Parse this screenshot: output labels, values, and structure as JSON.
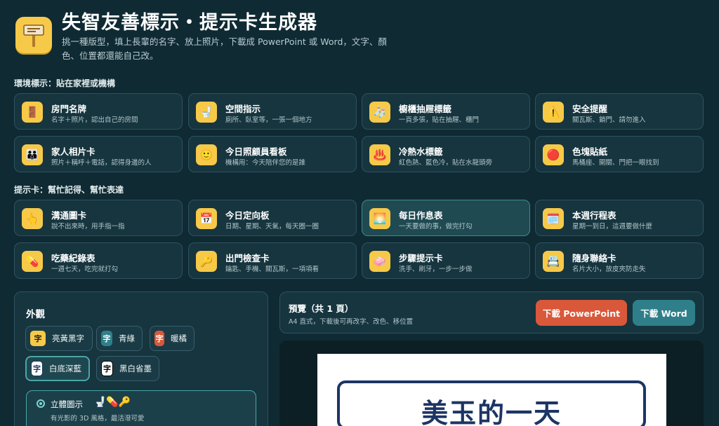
{
  "header": {
    "title": "失智友善標示・提示卡生成器",
    "subtitle": "挑一種版型，填上長輩的名字、放上照片，下載成 PowerPoint 或 Word，文字、顏色、位置都還能自己改。",
    "logo_icon": "signpost-icon"
  },
  "sections": {
    "environment": "環境標示：貼在家裡或機構",
    "prompt_cards": "提示卡：幫忙記得、幫忙表達"
  },
  "environment_cards": [
    {
      "title": "房門名牌",
      "desc": "名字＋照片，認出自己的房間",
      "icon": "door-icon",
      "glyph": "🚪"
    },
    {
      "title": "空間指示",
      "desc": "廁所、臥室等，一張一個地方",
      "icon": "toilet-icon",
      "glyph": "🚽"
    },
    {
      "title": "櫥櫃抽屜標籤",
      "desc": "一頁多張，貼在抽屜、櫃門",
      "icon": "socks-icon",
      "glyph": "🧦"
    },
    {
      "title": "安全提醒",
      "desc": "關瓦斯、鎖門、請勿進入",
      "icon": "warning-icon",
      "glyph": "⚠️"
    },
    {
      "title": "家人相片卡",
      "desc": "照片＋稱呼＋電話，認得身邊的人",
      "icon": "family-icon",
      "glyph": "👪"
    },
    {
      "title": "今日照顧員看板",
      "desc": "機構用：今天陪伴您的是誰",
      "icon": "caregiver-icon",
      "glyph": "🙂"
    },
    {
      "title": "冷熱水標籤",
      "desc": "紅色熱、藍色冷，貼在水龍頭旁",
      "icon": "hot-water-icon",
      "glyph": "♨️"
    },
    {
      "title": "色塊貼紙",
      "desc": "馬桶座、開關、門把一眼找到",
      "icon": "red-circle-icon",
      "glyph": "🔴"
    }
  ],
  "prompt_cards": [
    {
      "title": "溝通圖卡",
      "desc": "說不出來時，用手指一指",
      "icon": "pointing-hand-icon",
      "glyph": "👆"
    },
    {
      "title": "今日定向板",
      "desc": "日期、星期、天氣，每天圈一圈",
      "icon": "calendar-icon",
      "glyph": "📅"
    },
    {
      "title": "每日作息表",
      "desc": "一天要做的事，做完打勾",
      "icon": "sunrise-icon",
      "glyph": "🌅",
      "active": true
    },
    {
      "title": "本週行程表",
      "desc": "星期一到日，這週要做什麼",
      "icon": "week-calendar-icon",
      "glyph": "🗓️"
    },
    {
      "title": "吃藥紀錄表",
      "desc": "一週七天，吃完就打勾",
      "icon": "pill-icon",
      "glyph": "💊"
    },
    {
      "title": "出門檢查卡",
      "desc": "鑰匙、手機、關瓦斯，一項項看",
      "icon": "key-icon",
      "glyph": "🔑"
    },
    {
      "title": "步驟提示卡",
      "desc": "洗手、刷牙，一步一步做",
      "icon": "soap-icon",
      "glyph": "🧼"
    },
    {
      "title": "隨身聯絡卡",
      "desc": "名片大小，放皮夾防走失",
      "icon": "id-card-icon",
      "glyph": "📇"
    }
  ],
  "appearance": {
    "heading": "外觀",
    "chip_char": "字",
    "themes": [
      {
        "name": "亮黃黑字",
        "chip_bg": "#f7c948",
        "chip_fg": "#1a1a1a"
      },
      {
        "name": "青綠",
        "chip_bg": "#2f7f8a",
        "chip_fg": "#ffffff"
      },
      {
        "name": "暖橘",
        "chip_bg": "#d9583a",
        "chip_fg": "#ffffff"
      },
      {
        "name": "白底深藍",
        "chip_bg": "#ffffff",
        "chip_fg": "#1d3564",
        "selected": true
      },
      {
        "name": "黑白省墨",
        "chip_bg": "#ffffff",
        "chip_fg": "#000000"
      }
    ],
    "style_option": {
      "title": "立體圖示",
      "desc": "有光影的 3D 風格，最活潑可愛",
      "icons": [
        "toilet-icon",
        "pill-icon",
        "key-icon"
      ],
      "glyphs": "🚽💊🔑"
    }
  },
  "preview": {
    "title": "預覽（共 1 頁）",
    "desc": "A4 直式，下載後可再改字、改色、移位置",
    "download_ppt": "下載 PowerPoint",
    "download_word": "下載 Word",
    "sign_text": "美玉的一天"
  },
  "colors": {
    "background": "#0f2a33",
    "accent_yellow": "#f7c948",
    "accent_orange": "#d9583a",
    "accent_teal": "#2f7f8a",
    "sign_navy": "#1d3564"
  }
}
